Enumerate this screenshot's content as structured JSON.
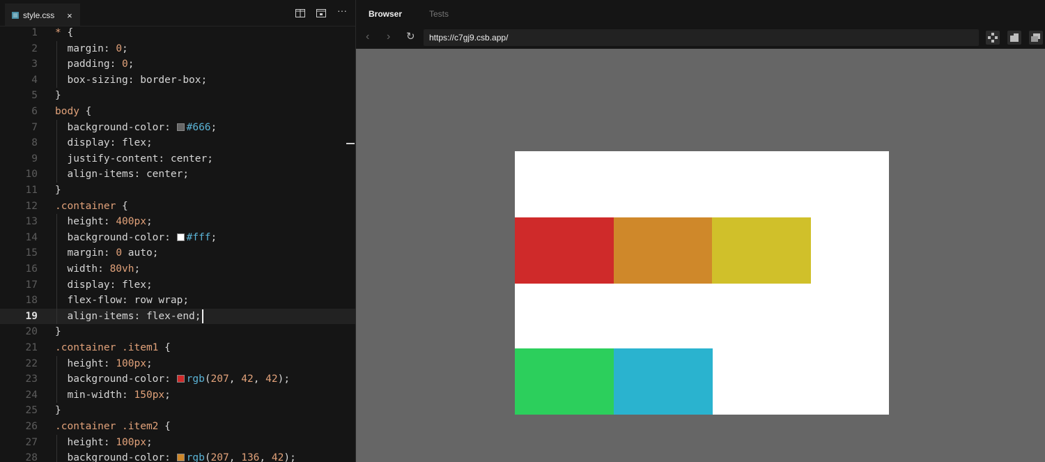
{
  "editor": {
    "tab": {
      "filename": "style.css",
      "close": "×"
    },
    "toolbar_icons": [
      "split-editor-icon",
      "preview-icon",
      "more-icon"
    ],
    "more_label": "···",
    "active_line": 19,
    "lines": [
      {
        "n": "1",
        "segments": [
          {
            "c": "star",
            "t": "* "
          },
          {
            "c": "kw",
            "t": "{"
          }
        ]
      },
      {
        "n": "2",
        "segments": [
          {
            "c": "prop",
            "t": "  margin: "
          },
          {
            "c": "num",
            "t": "0"
          },
          {
            "c": "kw",
            "t": ";"
          }
        ]
      },
      {
        "n": "3",
        "segments": [
          {
            "c": "prop",
            "t": "  padding: "
          },
          {
            "c": "num",
            "t": "0"
          },
          {
            "c": "kw",
            "t": ";"
          }
        ]
      },
      {
        "n": "4",
        "segments": [
          {
            "c": "prop",
            "t": "  box-sizing: border-box;"
          }
        ]
      },
      {
        "n": "5",
        "segments": [
          {
            "c": "kw",
            "t": "}"
          }
        ]
      },
      {
        "n": "6",
        "segments": [
          {
            "c": "sel",
            "t": "body "
          },
          {
            "c": "kw",
            "t": "{"
          }
        ]
      },
      {
        "n": "7",
        "segments": [
          {
            "c": "prop",
            "t": "  background-color: "
          },
          {
            "c": "swatch",
            "t": "#666666"
          },
          {
            "c": "hex",
            "t": "#666"
          },
          {
            "c": "kw",
            "t": ";"
          }
        ]
      },
      {
        "n": "8",
        "segments": [
          {
            "c": "prop",
            "t": "  display: flex;"
          }
        ]
      },
      {
        "n": "9",
        "segments": [
          {
            "c": "prop",
            "t": "  justify-content: center;"
          }
        ]
      },
      {
        "n": "10",
        "segments": [
          {
            "c": "prop",
            "t": "  align-items: center;"
          }
        ]
      },
      {
        "n": "11",
        "segments": [
          {
            "c": "kw",
            "t": "}"
          }
        ]
      },
      {
        "n": "12",
        "segments": [
          {
            "c": "sel",
            "t": ".container "
          },
          {
            "c": "kw",
            "t": "{"
          }
        ]
      },
      {
        "n": "13",
        "segments": [
          {
            "c": "prop",
            "t": "  height: "
          },
          {
            "c": "num",
            "t": "400px"
          },
          {
            "c": "kw",
            "t": ";"
          }
        ]
      },
      {
        "n": "14",
        "segments": [
          {
            "c": "prop",
            "t": "  background-color: "
          },
          {
            "c": "swatch",
            "t": "#ffffff"
          },
          {
            "c": "hex",
            "t": "#fff"
          },
          {
            "c": "kw",
            "t": ";"
          }
        ]
      },
      {
        "n": "15",
        "segments": [
          {
            "c": "prop",
            "t": "  margin: "
          },
          {
            "c": "num",
            "t": "0"
          },
          {
            "c": "prop",
            "t": " auto;"
          }
        ]
      },
      {
        "n": "16",
        "segments": [
          {
            "c": "prop",
            "t": "  width: "
          },
          {
            "c": "num",
            "t": "80vh"
          },
          {
            "c": "kw",
            "t": ";"
          }
        ]
      },
      {
        "n": "17",
        "segments": [
          {
            "c": "prop",
            "t": "  display: flex;"
          }
        ]
      },
      {
        "n": "18",
        "segments": [
          {
            "c": "prop",
            "t": "  flex-flow: row wrap;"
          }
        ]
      },
      {
        "n": "19",
        "segments": [
          {
            "c": "prop",
            "t": "  align-items: flex-end;"
          }
        ]
      },
      {
        "n": "20",
        "segments": [
          {
            "c": "kw",
            "t": "}"
          }
        ]
      },
      {
        "n": "21",
        "segments": [
          {
            "c": "sel",
            "t": ".container .item1 "
          },
          {
            "c": "kw",
            "t": "{"
          }
        ]
      },
      {
        "n": "22",
        "segments": [
          {
            "c": "prop",
            "t": "  height: "
          },
          {
            "c": "num",
            "t": "100px"
          },
          {
            "c": "kw",
            "t": ";"
          }
        ]
      },
      {
        "n": "23",
        "segments": [
          {
            "c": "prop",
            "t": "  background-color: "
          },
          {
            "c": "swatch",
            "t": "#cf2a2a"
          },
          {
            "c": "fn",
            "t": "rgb"
          },
          {
            "c": "kw",
            "t": "("
          },
          {
            "c": "num",
            "t": "207"
          },
          {
            "c": "kw",
            "t": ", "
          },
          {
            "c": "num",
            "t": "42"
          },
          {
            "c": "kw",
            "t": ", "
          },
          {
            "c": "num",
            "t": "42"
          },
          {
            "c": "kw",
            "t": ");"
          }
        ]
      },
      {
        "n": "24",
        "segments": [
          {
            "c": "prop",
            "t": "  min-width: "
          },
          {
            "c": "num",
            "t": "150px"
          },
          {
            "c": "kw",
            "t": ";"
          }
        ]
      },
      {
        "n": "25",
        "segments": [
          {
            "c": "kw",
            "t": "}"
          }
        ]
      },
      {
        "n": "26",
        "segments": [
          {
            "c": "sel",
            "t": ".container .item2 "
          },
          {
            "c": "kw",
            "t": "{"
          }
        ]
      },
      {
        "n": "27",
        "segments": [
          {
            "c": "prop",
            "t": "  height: "
          },
          {
            "c": "num",
            "t": "100px"
          },
          {
            "c": "kw",
            "t": ";"
          }
        ]
      },
      {
        "n": "28",
        "segments": [
          {
            "c": "prop",
            "t": "  background-color: "
          },
          {
            "c": "swatch",
            "t": "#cf882a"
          },
          {
            "c": "fn",
            "t": "rgb"
          },
          {
            "c": "kw",
            "t": "("
          },
          {
            "c": "num",
            "t": "207"
          },
          {
            "c": "kw",
            "t": ", "
          },
          {
            "c": "num",
            "t": "136"
          },
          {
            "c": "kw",
            "t": ", "
          },
          {
            "c": "num",
            "t": "42"
          },
          {
            "c": "kw",
            "t": ");"
          }
        ]
      }
    ]
  },
  "preview": {
    "tabs": [
      {
        "label": "Browser",
        "active": true
      },
      {
        "label": "Tests",
        "active": false
      }
    ],
    "nav": {
      "back": "‹",
      "forward": "›",
      "refresh": "↻"
    },
    "url": "https://c7gj9.csb.app/",
    "right_icons": [
      "move-icon",
      "open-new-window-icon",
      "restore-icon"
    ],
    "page": {
      "background": "#666666",
      "container_background": "#ffffff",
      "items": [
        {
          "name": "item1",
          "color": "#cf2a2a"
        },
        {
          "name": "item2",
          "color": "#cf882a"
        },
        {
          "name": "item3",
          "color": "#d0c02a"
        },
        {
          "name": "item4",
          "color": "#2ccf5c"
        },
        {
          "name": "item5",
          "color": "#2ab3cf"
        }
      ]
    }
  }
}
